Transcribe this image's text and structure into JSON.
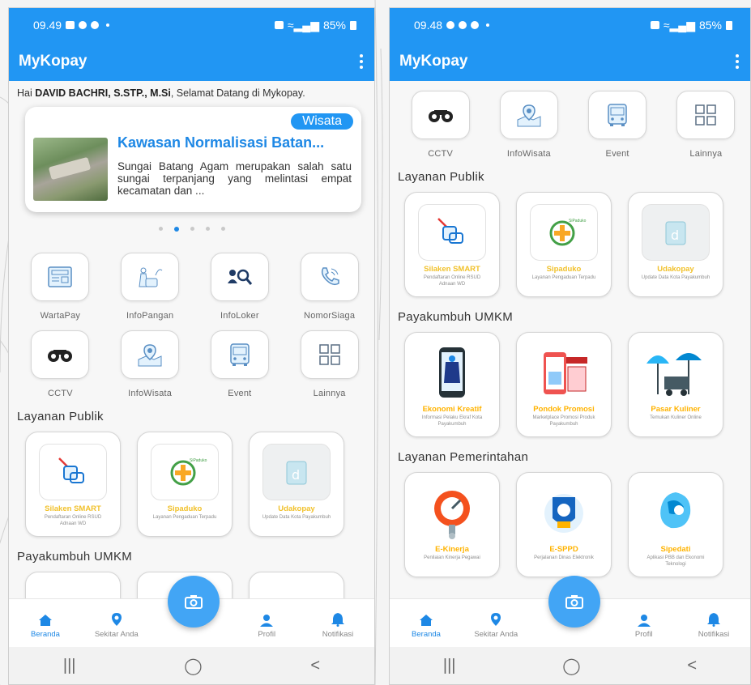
{
  "left": {
    "status": {
      "time": "09.49",
      "battery": "85%"
    },
    "app_title": "MyKopay",
    "greeting": {
      "prefix": "Hai ",
      "name": "DAVID BACHRI, S.STP., M.Si",
      "suffix": ", Selamat Datang di Mykopay."
    },
    "banner": {
      "tag": "Wisata",
      "title": "Kawasan Normalisasi Batan...",
      "description": "Sungai Batang Agam merupakan salah satu sungai terpanjang yang melintasi empat kecamatan dan ..."
    },
    "menu": [
      {
        "label": "WartaPay",
        "icon": "newspaper-icon"
      },
      {
        "label": "InfoPangan",
        "icon": "food-icon"
      },
      {
        "label": "InfoLoker",
        "icon": "job-search-icon"
      },
      {
        "label": "NomorSiaga",
        "icon": "phone-icon"
      },
      {
        "label": "CCTV",
        "icon": "binoculars-icon"
      },
      {
        "label": "InfoWisata",
        "icon": "map-pin-icon"
      },
      {
        "label": "Event",
        "icon": "bus-icon"
      },
      {
        "label": "Lainnya",
        "icon": "grid-icon"
      }
    ],
    "sections": {
      "layanan_publik": "Layanan Publik",
      "umkm": "Payakumbuh UMKM"
    },
    "layanan_publik": [
      {
        "title": "Silaken SMART",
        "subtitle": "Pendaftaran Online RSUD Adnaan WD"
      },
      {
        "title": "Sipaduko",
        "subtitle": "Layanan Pengaduan Terpadu"
      },
      {
        "title": "Udakopay",
        "subtitle": "Update Data Kota Payakumbuh"
      }
    ]
  },
  "right": {
    "status": {
      "time": "09.48",
      "battery": "85%"
    },
    "app_title": "MyKopay",
    "menu": [
      {
        "label": "CCTV",
        "icon": "binoculars-icon"
      },
      {
        "label": "InfoWisata",
        "icon": "map-pin-icon"
      },
      {
        "label": "Event",
        "icon": "bus-icon"
      },
      {
        "label": "Lainnya",
        "icon": "grid-icon"
      }
    ],
    "sections": {
      "layanan_publik": "Layanan Publik",
      "umkm": "Payakumbuh UMKM",
      "pemerintahan": "Layanan Pemerintahan"
    },
    "layanan_publik": [
      {
        "title": "Silaken SMART",
        "subtitle": "Pendaftaran Online RSUD Adnaan WD"
      },
      {
        "title": "Sipaduko",
        "subtitle": "Layanan Pengaduan Terpadu"
      },
      {
        "title": "Udakopay",
        "subtitle": "Update Data Kota Payakumbuh"
      }
    ],
    "umkm": [
      {
        "title": "Ekonomi Kreatif",
        "subtitle": "Informasi Pelaku Ekraf Kota Payakumbuh"
      },
      {
        "title": "Pondok Promosi",
        "subtitle": "Marketplace Promosi Produk Payakumbuh"
      },
      {
        "title": "Pasar Kuliner",
        "subtitle": "Temukan Kuliner Online"
      }
    ],
    "pemerintahan": [
      {
        "title": "E-Kinerja",
        "subtitle": "Penilaian Kinerja Pegawai"
      },
      {
        "title": "E-SPPD",
        "subtitle": "Perjalanan Dinas Elektronik"
      },
      {
        "title": "Sipedati",
        "subtitle": "Aplikasi PBB dan Ekonomi Teknologi"
      }
    ]
  },
  "bottom_nav": {
    "home": "Beranda",
    "nearby": "Sekitar Anda",
    "profile": "Profil",
    "notifications": "Notifikasi"
  },
  "colors": {
    "primary": "#2196f3",
    "accent_yellow": "#f1c12b",
    "fab": "#42a5f5"
  }
}
